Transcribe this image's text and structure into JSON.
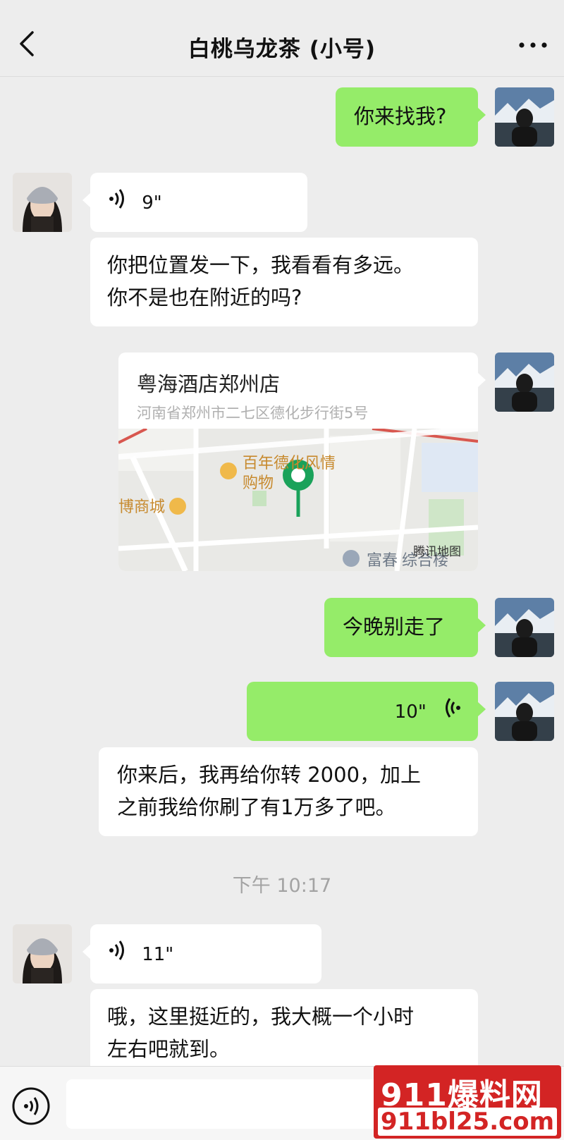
{
  "header": {
    "title": "白桃乌龙茶 (小号)"
  },
  "messages": {
    "m1": {
      "text": "你来找我?"
    },
    "m2": {
      "duration": "9\""
    },
    "m3": {
      "line1": "你把位置发一下，我看看有多远。",
      "line2": "你不是也在附近的吗?"
    },
    "m4": {
      "name": "粤海酒店郑州店",
      "address": "河南省郑州市二七区德化步行街5号",
      "map_poi1_line1": "百年德化风情",
      "map_poi1_line2": "购物",
      "map_poi2": "博商城",
      "map_poi3": "富春",
      "map_poi3_suffix": "综合楼",
      "map_attribution": "腾讯地图"
    },
    "m5": {
      "text": "今晚别走了"
    },
    "m6": {
      "duration": "10\""
    },
    "m7": {
      "line1": "你来后，我再给你转 2000，加上",
      "line2": "之前我给你刷了有1万多了吧。"
    },
    "time": "下午 10:17",
    "m8": {
      "duration": "11\""
    },
    "m9": {
      "line1": "哦，这里挺近的，我大概一个小时",
      "line2": "左右吧就到。"
    }
  },
  "watermark": {
    "top": "911爆料网",
    "bottom": "911bl25.com"
  },
  "colors": {
    "green_bubble": "#95ec69",
    "background": "#ededed",
    "watermark": "#d32424"
  }
}
